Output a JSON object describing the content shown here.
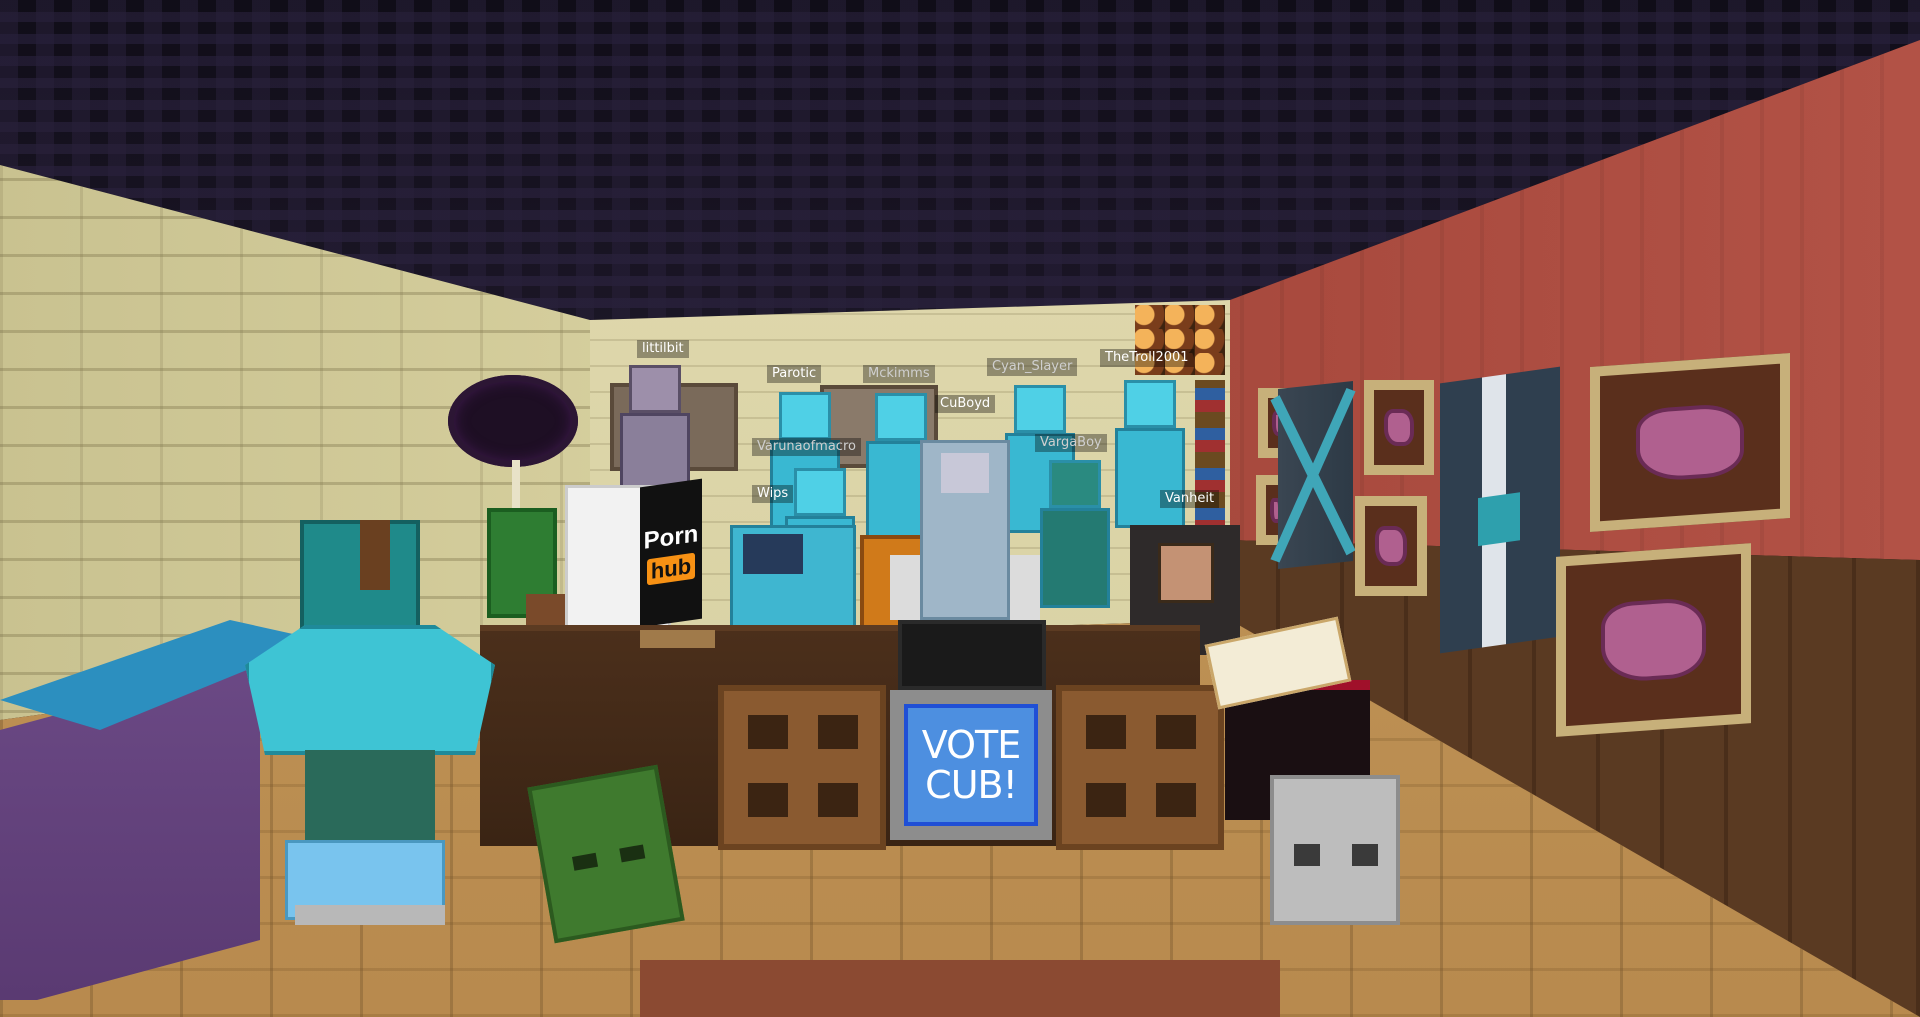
{
  "scene": {
    "room": "minecraft-interior",
    "colors": {
      "ceiling": "#151120",
      "left_wall": "#d3cc9a",
      "right_wall": "#a4463a",
      "floor": "#c09558",
      "accent_blue": "#4d8fe0"
    }
  },
  "vote_box": {
    "line1": "VOTE",
    "line2": "CUB!"
  },
  "computer_screen": {
    "line1": "Porn",
    "line2": "hub"
  },
  "players": [
    {
      "name": "littilbit",
      "id": "littilbit"
    },
    {
      "name": "Parotic",
      "id": "parotic"
    },
    {
      "name": "Mckimms",
      "id": "mckimms"
    },
    {
      "name": "Cyan_Slayer",
      "id": "cyan-slayer"
    },
    {
      "name": "TheTroll2001",
      "id": "thetroll2001"
    },
    {
      "name": "CuBoyd",
      "id": "cuboyd"
    },
    {
      "name": "Varunaofmacro",
      "id": "varunaofmacro"
    },
    {
      "name": "VargaBoy",
      "id": "vargaboy"
    },
    {
      "name": "Wips",
      "id": "wips"
    },
    {
      "name": "Vanheit",
      "id": "vanheit"
    }
  ],
  "icons": [
    "zombie-head-icon",
    "skeleton-skull-icon",
    "ender-pearl-tree-icon",
    "cactus-icon",
    "enchanting-table-icon",
    "steak-painting-icon",
    "banner-icon"
  ]
}
